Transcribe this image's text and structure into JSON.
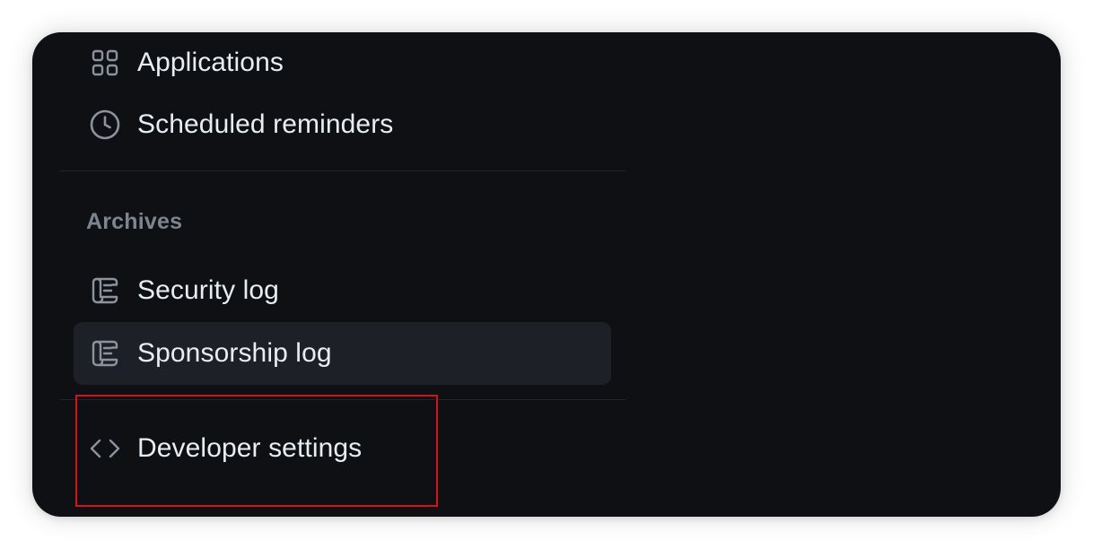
{
  "sidebar": {
    "top_items": [
      {
        "label": "Applications",
        "icon": "apps-grid-icon"
      },
      {
        "label": "Scheduled reminders",
        "icon": "clock-icon"
      }
    ],
    "archives": {
      "heading": "Archives",
      "items": [
        {
          "label": "Security log",
          "icon": "log-icon",
          "selected": false
        },
        {
          "label": "Sponsorship log",
          "icon": "log-icon",
          "selected": true
        }
      ]
    },
    "developer": {
      "label": "Developer settings",
      "icon": "code-icon"
    }
  },
  "colors": {
    "background": "#0e1014",
    "selected_item": "#1d2026",
    "text": "#e6edf3",
    "muted": "#7d8590",
    "divider": "#21262d",
    "highlight": "#d6121b"
  }
}
